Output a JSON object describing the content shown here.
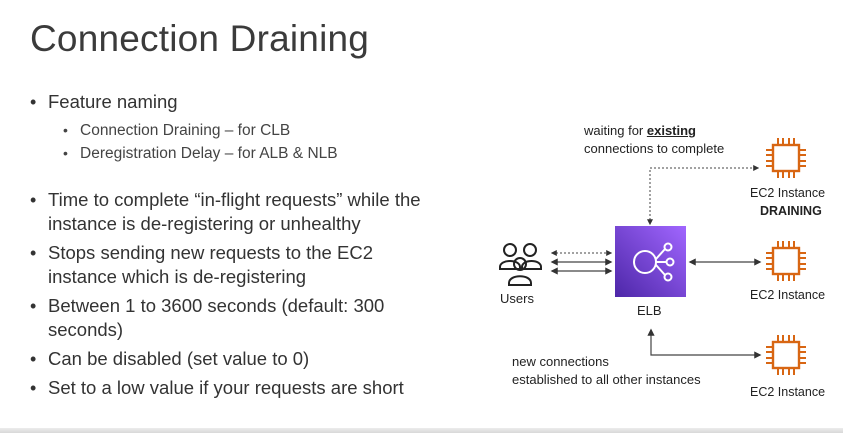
{
  "title": "Connection Draining",
  "bullets": {
    "feature_naming": "Feature naming",
    "sub1": "Connection Draining – for CLB",
    "sub2": "Deregistration Delay – for ALB & NLB",
    "b_time_line1": "Time to complete “in-flight requests” while the",
    "b_time_line2": "instance is de-registering or unhealthy",
    "b_stops_line1": "Stops sending new requests to the EC2",
    "b_stops_line2": "instance which is de-registering",
    "b_between_line1": "Between 1 to 3600 seconds (default: 300",
    "b_between_line2": "seconds)",
    "b_disabled": "Can be disabled (set value to 0)",
    "b_low": "Set to a low value if your requests are short"
  },
  "diagram": {
    "waiting_prefix": "waiting for ",
    "waiting_emph": "existing",
    "waiting_line2": "connections to complete",
    "ec2_draining_label": "EC2 Instance",
    "draining_status": "DRAINING",
    "ec2_label_2": "EC2 Instance",
    "ec2_label_3": "EC2 Instance",
    "users_label": "Users",
    "elb_label": "ELB",
    "new_conn_line1": "new connections",
    "new_conn_line2": "established to all other instances"
  },
  "colors": {
    "elb_dark": "#4d27a8",
    "elb_light": "#a166ff",
    "ec2_orange": "#d86613",
    "text": "#2f2f2f"
  }
}
